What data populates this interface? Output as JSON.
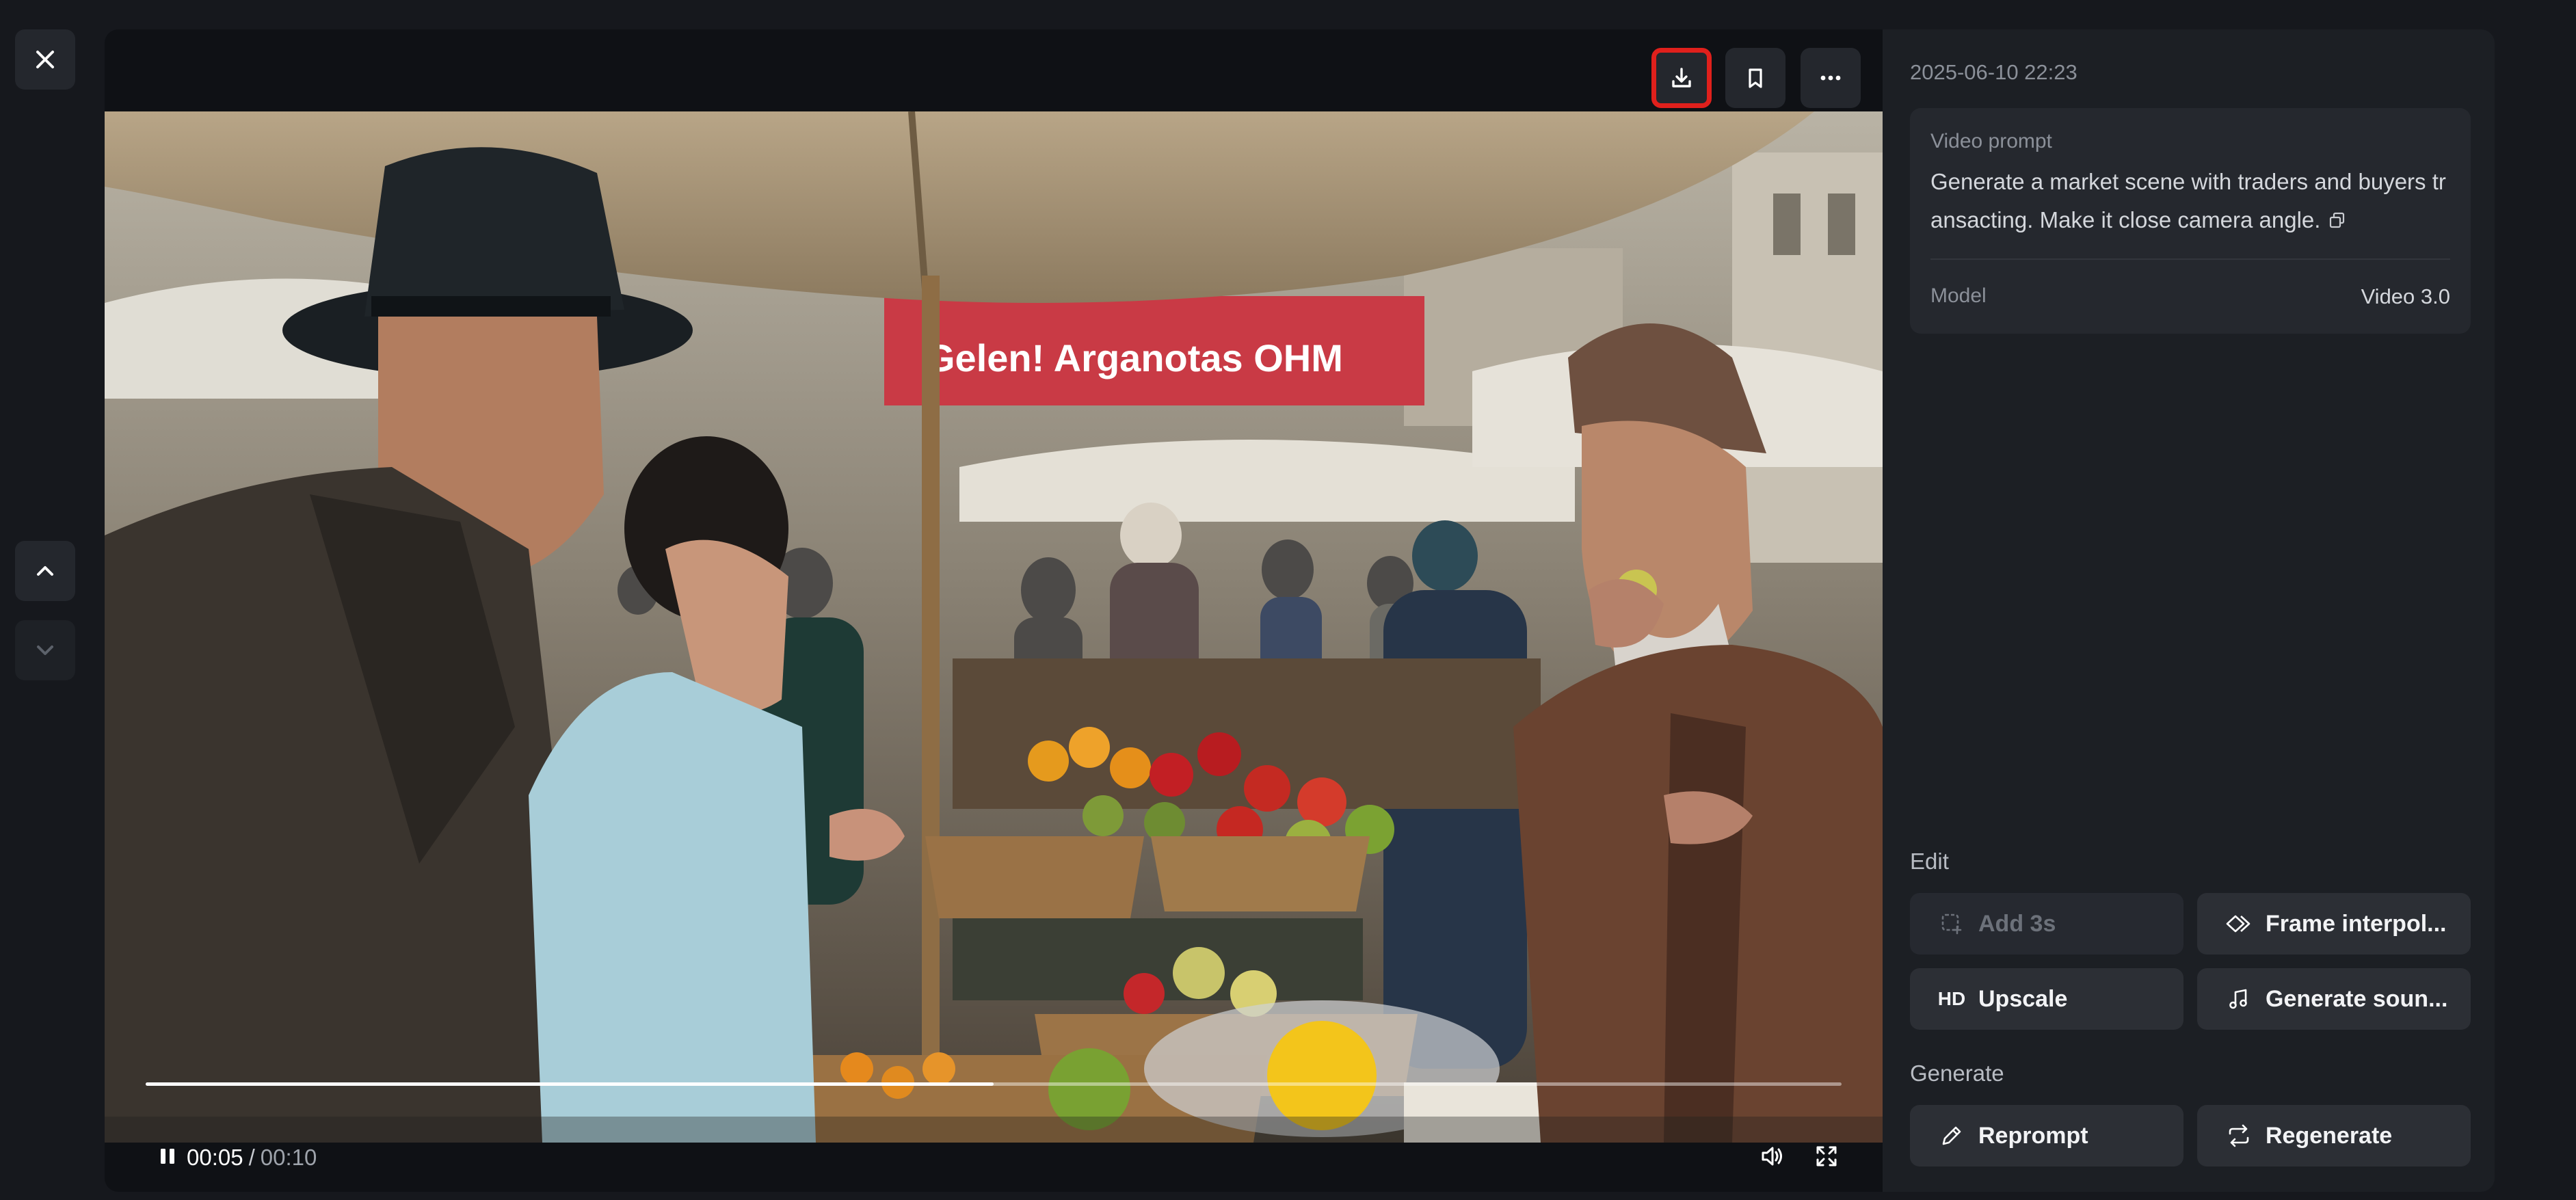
{
  "player": {
    "time_current": "00:05",
    "time_separator": "/",
    "time_total": "00:10",
    "progress_fraction": 0.5,
    "is_playing": true
  },
  "toolbar": {
    "download_icon": "download-icon",
    "bookmark_icon": "bookmark-icon",
    "more_icon": "more-horizontal-icon"
  },
  "video": {
    "sign_text": "Gelen! Arganotas OHM"
  },
  "panel": {
    "timestamp": "2025-06-10 22:23",
    "prompt_label": "Video prompt",
    "prompt_text": "Generate a market scene with traders and buyers transacting. Make it close camera angle.",
    "model_label": "Model",
    "model_value": "Video 3.0",
    "edit_title": "Edit",
    "generate_title": "Generate",
    "buttons": {
      "add3s": "Add 3s",
      "frame_interp": "Frame interpol...",
      "upscale_prefix": "HD",
      "upscale": "Upscale",
      "generate_sound": "Generate soun...",
      "reprompt": "Reprompt",
      "regenerate": "Regenerate"
    }
  },
  "colors": {
    "highlight_border": "#e0201c",
    "background": "#16181d",
    "panel": "#1c1f24"
  }
}
